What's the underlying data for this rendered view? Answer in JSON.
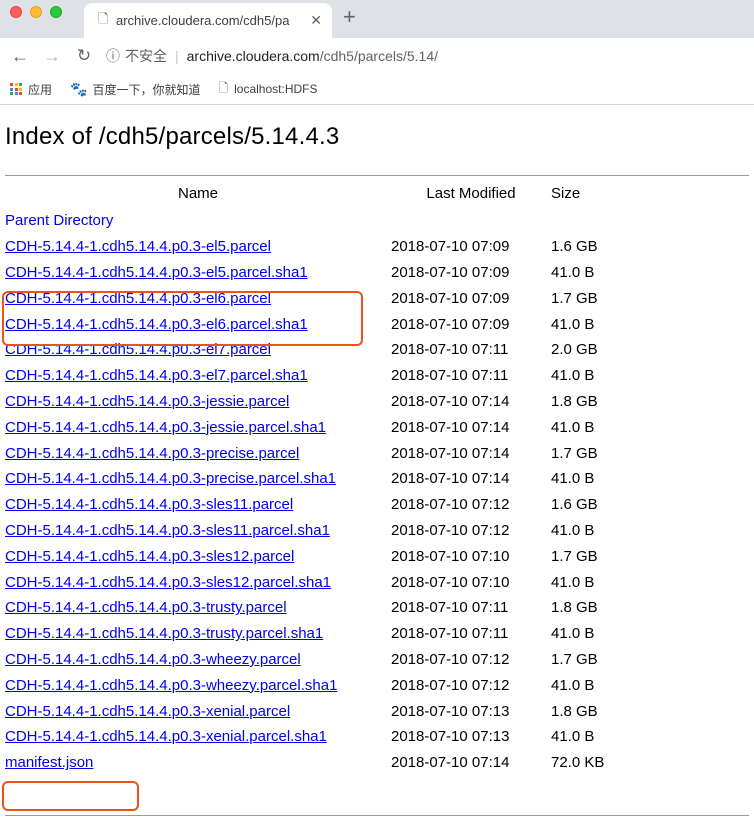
{
  "browser": {
    "tab": {
      "title": "archive.cloudera.com/cdh5/pa",
      "close": "✕"
    },
    "new_tab": "+",
    "url": {
      "security_label": "不安全",
      "host": "archive.cloudera.com",
      "path": "/cdh5/parcels/5.14/"
    },
    "bookmarks": [
      {
        "label": "应用"
      },
      {
        "label": "百度一下，你就知道"
      },
      {
        "label": "localhost:HDFS"
      }
    ],
    "colors": {
      "tab_strip": "#dee1e6",
      "apps_grid": [
        "#ea4335",
        "#fbbc05",
        "#34a853",
        "#4285f4",
        "#ea4335",
        "#fbbc05",
        "#34a853",
        "#4285f4",
        "#ea4335"
      ]
    }
  },
  "page": {
    "title": "Index of /cdh5/parcels/5.14.4.3",
    "headers": {
      "name": "Name",
      "modified": "Last Modified",
      "size": "Size"
    },
    "parent": "Parent Directory",
    "rows": [
      {
        "name": "CDH-5.14.4-1.cdh5.14.4.p0.3-el5.parcel",
        "modified": "2018-07-10 07:09",
        "size": "1.6 GB"
      },
      {
        "name": "CDH-5.14.4-1.cdh5.14.4.p0.3-el5.parcel.sha1",
        "modified": "2018-07-10 07:09",
        "size": "41.0 B"
      },
      {
        "name": "CDH-5.14.4-1.cdh5.14.4.p0.3-el6.parcel",
        "modified": "2018-07-10 07:09",
        "size": "1.7 GB"
      },
      {
        "name": "CDH-5.14.4-1.cdh5.14.4.p0.3-el6.parcel.sha1",
        "modified": "2018-07-10 07:09",
        "size": "41.0 B"
      },
      {
        "name": "CDH-5.14.4-1.cdh5.14.4.p0.3-el7.parcel",
        "modified": "2018-07-10 07:11",
        "size": "2.0 GB"
      },
      {
        "name": "CDH-5.14.4-1.cdh5.14.4.p0.3-el7.parcel.sha1",
        "modified": "2018-07-10 07:11",
        "size": "41.0 B"
      },
      {
        "name": "CDH-5.14.4-1.cdh5.14.4.p0.3-jessie.parcel",
        "modified": "2018-07-10 07:14",
        "size": "1.8 GB"
      },
      {
        "name": "CDH-5.14.4-1.cdh5.14.4.p0.3-jessie.parcel.sha1",
        "modified": "2018-07-10 07:14",
        "size": "41.0 B"
      },
      {
        "name": "CDH-5.14.4-1.cdh5.14.4.p0.3-precise.parcel",
        "modified": "2018-07-10 07:14",
        "size": "1.7 GB"
      },
      {
        "name": "CDH-5.14.4-1.cdh5.14.4.p0.3-precise.parcel.sha1",
        "modified": "2018-07-10 07:14",
        "size": "41.0 B"
      },
      {
        "name": "CDH-5.14.4-1.cdh5.14.4.p0.3-sles11.parcel",
        "modified": "2018-07-10 07:12",
        "size": "1.6 GB"
      },
      {
        "name": "CDH-5.14.4-1.cdh5.14.4.p0.3-sles11.parcel.sha1",
        "modified": "2018-07-10 07:12",
        "size": "41.0 B"
      },
      {
        "name": "CDH-5.14.4-1.cdh5.14.4.p0.3-sles12.parcel",
        "modified": "2018-07-10 07:10",
        "size": "1.7 GB"
      },
      {
        "name": "CDH-5.14.4-1.cdh5.14.4.p0.3-sles12.parcel.sha1",
        "modified": "2018-07-10 07:10",
        "size": "41.0 B"
      },
      {
        "name": "CDH-5.14.4-1.cdh5.14.4.p0.3-trusty.parcel",
        "modified": "2018-07-10 07:11",
        "size": "1.8 GB"
      },
      {
        "name": "CDH-5.14.4-1.cdh5.14.4.p0.3-trusty.parcel.sha1",
        "modified": "2018-07-10 07:11",
        "size": "41.0 B"
      },
      {
        "name": "CDH-5.14.4-1.cdh5.14.4.p0.3-wheezy.parcel",
        "modified": "2018-07-10 07:12",
        "size": "1.7 GB"
      },
      {
        "name": "CDH-5.14.4-1.cdh5.14.4.p0.3-wheezy.parcel.sha1",
        "modified": "2018-07-10 07:12",
        "size": "41.0 B"
      },
      {
        "name": "CDH-5.14.4-1.cdh5.14.4.p0.3-xenial.parcel",
        "modified": "2018-07-10 07:13",
        "size": "1.8 GB"
      },
      {
        "name": "CDH-5.14.4-1.cdh5.14.4.p0.3-xenial.parcel.sha1",
        "modified": "2018-07-10 07:13",
        "size": "41.0 B"
      },
      {
        "name": "manifest.json",
        "modified": "2018-07-10 07:14",
        "size": "72.0 KB"
      }
    ],
    "highlight_color": "#e8541c"
  }
}
